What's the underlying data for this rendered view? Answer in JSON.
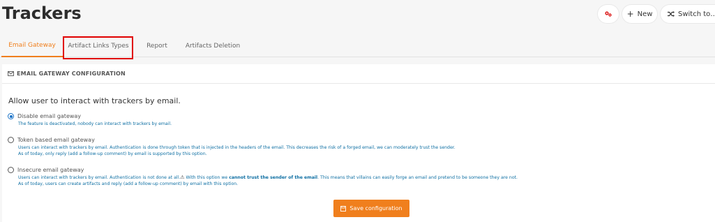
{
  "header": {
    "title": "Trackers",
    "new_label": "New",
    "switch_label": "Switch to…"
  },
  "tabs": [
    {
      "label": "Email Gateway",
      "active": true
    },
    {
      "label": "Artifact Links Types",
      "active": false
    },
    {
      "label": "Report",
      "active": false
    },
    {
      "label": "Artifacts Deletion",
      "active": false
    }
  ],
  "panel": {
    "heading": "EMAIL GATEWAY CONFIGURATION",
    "lead": "Allow user to interact with trackers by email.",
    "options": [
      {
        "label": "Disable email gateway",
        "checked": true,
        "desc_lines": [
          "The feature is deactivated, nobody can interact with trackers by email."
        ]
      },
      {
        "label": "Token based email gateway",
        "checked": false,
        "desc_lines": [
          "Users can interact with trackers by email. Authentication is done through token that is injected in the headers of the email. This decreases the risk of a forged email, we can moderately trust the sender.",
          "As of today, only reply (add a follow-up comment) by email is supported by this option."
        ]
      },
      {
        "label": "Insecure email gateway",
        "checked": false,
        "desc_pre": "Users can interact with trackers by email. Authentication is not done at all.",
        "desc_mid_pre": " With this option we ",
        "desc_bold": "cannot trust the sender of the email",
        "desc_post": ". This means that villains can easily forge an email and pretend to be someone they are not.",
        "desc_line2": "As of today, users can create artifacts and reply (add a follow-up comment) by email with this option."
      }
    ],
    "save_label": "Save configuration"
  },
  "colors": {
    "accent": "#f07f1d",
    "link_text": "#0e6fa3",
    "highlight": "#e00000"
  }
}
